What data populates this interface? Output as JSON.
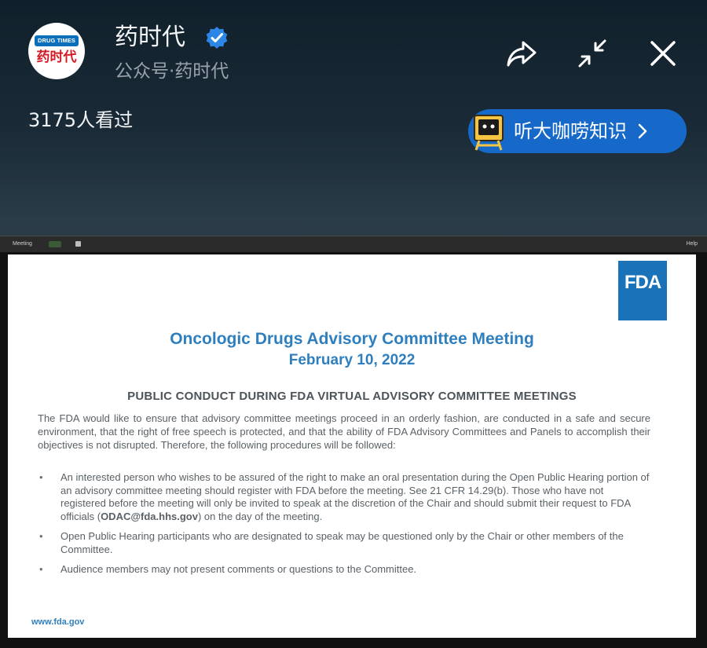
{
  "account": {
    "logo_top": "DRUG TIMES",
    "logo_bottom": "药时代",
    "name": "药时代",
    "subtitle": "公众号·药时代"
  },
  "views": "3175人看过",
  "listen_pill": {
    "label": "听大咖唠知识"
  },
  "meeting_bar": {
    "meeting_label": "Meeting",
    "help_label": "Help"
  },
  "slide": {
    "logo": "FDA",
    "title": "Oncologic Drugs Advisory Committee Meeting",
    "date": "February 10, 2022",
    "heading": "PUBLIC CONDUCT DURING FDA VIRTUAL ADVISORY COMMITTEE MEETINGS",
    "intro": "The FDA would like to ensure that advisory committee meetings proceed in an orderly fashion, are conducted in a safe and secure environment, that the right of free speech is protected, and that the ability of FDA Advisory Committees and Panels to accomplish their objectives is not disrupted. Therefore, the following procedures will be followed:",
    "bullet_mark": "•",
    "bullet1_a": "An interested person who wishes to be assured of the right to make an oral presentation during the Open Public Hearing portion of an advisory committee meeting should register with FDA before the meeting. See 21 CFR 14.29(b).  Those who have not registered before the meeting will only be invited to speak at the discretion of the Chair and should submit their request to FDA officials (",
    "bullet1_email": "ODAC@fda.hhs.gov",
    "bullet1_b": ") on the day of the meeting.",
    "bullet2": "Open Public Hearing participants who are designated to speak may be questioned only by the Chair or other members of the Committee.",
    "bullet3": "Audience members may not present comments or questions to the Committee.",
    "url": "www.fda.gov"
  },
  "colors": {
    "accent_blue": "#1769c9",
    "fda_blue": "#1a73b8",
    "title_blue": "#2f7fbf"
  },
  "icons": [
    "share-icon",
    "shrink-icon",
    "close-icon",
    "verified-icon",
    "chevron-right-icon"
  ]
}
